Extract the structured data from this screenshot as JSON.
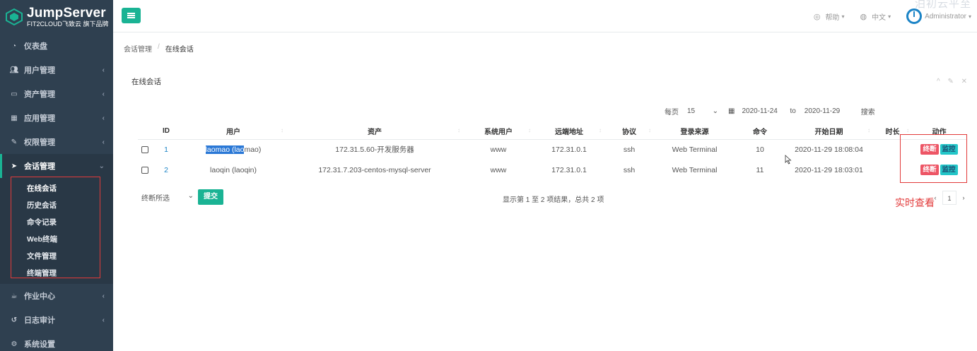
{
  "brand": {
    "title": "JumpServer",
    "subtitle": "FIT2CLOUD飞致云 旗下品牌"
  },
  "sidebar": {
    "items": [
      {
        "label": "仪表盘",
        "icon": "dashboard-icon",
        "has_children": false
      },
      {
        "label": "用户管理",
        "icon": "users-icon",
        "has_children": true
      },
      {
        "label": "资产管理",
        "icon": "inbox-icon",
        "has_children": true
      },
      {
        "label": "应用管理",
        "icon": "grid-icon",
        "has_children": true
      },
      {
        "label": "权限管理",
        "icon": "edit-icon",
        "has_children": true
      },
      {
        "label": "会话管理",
        "icon": "paper-plane-icon",
        "has_children": true,
        "expanded": true
      },
      {
        "label": "作业中心",
        "icon": "coffee-icon",
        "has_children": true
      },
      {
        "label": "日志审计",
        "icon": "history-icon",
        "has_children": true
      },
      {
        "label": "系统设置",
        "icon": "cogs-icon",
        "has_children": false
      }
    ],
    "session_submenu": [
      "在线会话",
      "历史会话",
      "命令记录",
      "Web终端",
      "文件管理",
      "终端管理"
    ]
  },
  "topbar": {
    "help": "帮助",
    "language": "中文",
    "user": "Administrator",
    "watermark": "泊初云平至"
  },
  "breadcrumb": {
    "parent": "会话管理",
    "separator": "/",
    "current": "在线会话"
  },
  "panel": {
    "title": "在线会话",
    "tools": "^ ✎ ✕"
  },
  "toolbar": {
    "per_page_label": "每页",
    "per_page_value": "15",
    "date_from": "2020-11-24",
    "to_label": "to",
    "date_to": "2020-11-29",
    "search_label": "搜索"
  },
  "table": {
    "columns": [
      "",
      "ID",
      "用户",
      "资产",
      "系统用户",
      "远端地址",
      "协议",
      "登录来源",
      "命令",
      "开始日期",
      "时长",
      "动作"
    ],
    "rows": [
      {
        "id": "1",
        "user_hl": "laomao (lao",
        "user_rest": "mao)",
        "asset": "172.31.5.60-开发服务器",
        "system_user": "www",
        "remote_addr": "172.31.0.1",
        "protocol": "ssh",
        "login_from": "Web Terminal",
        "commands": "10",
        "date_start": "2020-11-29 18:08:04",
        "duration": "",
        "action_terminate": "终断",
        "action_monitor": "监控"
      },
      {
        "id": "2",
        "user_hl": "",
        "user_rest": "laoqin (laoqin)",
        "asset": "172.31.7.203-centos-mysql-server",
        "system_user": "www",
        "remote_addr": "172.31.0.1",
        "protocol": "ssh",
        "login_from": "Web Terminal",
        "commands": "11",
        "date_start": "2020-11-29 18:03:01",
        "duration": "",
        "action_terminate": "终断",
        "action_monitor": "监控"
      }
    ]
  },
  "bulk": {
    "select_label": "终断所选",
    "submit_label": "提交"
  },
  "summary": "显示第 1 至 2 项结果，总共 2 项",
  "pager": {
    "prev": "‹",
    "current": "1",
    "next": "›"
  },
  "annotation": "实时查看",
  "colors": {
    "sidebar_bg": "#2f4050",
    "primary": "#1ab394",
    "danger": "#ed5565",
    "info": "#23c6c8",
    "annotation": "#e23a3a"
  }
}
